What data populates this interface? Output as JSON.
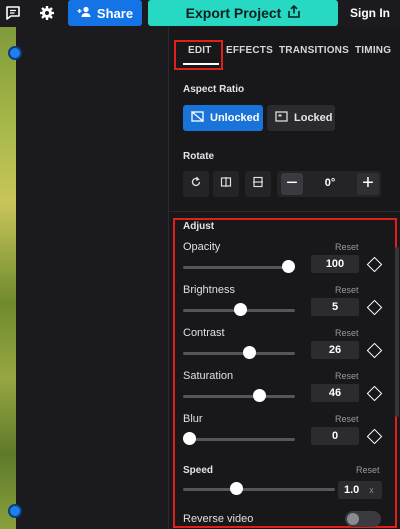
{
  "topbar": {
    "share_label": "Share",
    "export_label": "Export Project",
    "signin_label": "Sign In",
    "icons": [
      "chat-icon",
      "gear-icon",
      "add-user-icon",
      "share-out-icon"
    ]
  },
  "tabs": [
    {
      "label": "EDIT",
      "active": true
    },
    {
      "label": "EFFECTS"
    },
    {
      "label": "TRANSITIONS"
    },
    {
      "label": "TIMING"
    }
  ],
  "aspect_ratio": {
    "title": "Aspect Ratio",
    "unlocked_label": "Unlocked",
    "locked_label": "Locked"
  },
  "rotate": {
    "title": "Rotate",
    "value": "0°",
    "minus": "−",
    "plus": "+"
  },
  "adjust": {
    "title": "Adjust",
    "reset_label": "Reset",
    "rows": [
      {
        "label": "Opacity",
        "value": "100",
        "fraction": 1.0
      },
      {
        "label": "Brightness",
        "value": "5",
        "fraction": 0.52
      },
      {
        "label": "Contrast",
        "value": "26",
        "fraction": 0.61
      },
      {
        "label": "Saturation",
        "value": "46",
        "fraction": 0.71
      },
      {
        "label": "Blur",
        "value": "0",
        "fraction": 0.0
      }
    ]
  },
  "speed": {
    "title": "Speed",
    "reset_label": "Reset",
    "value": "1.0",
    "unit": "x",
    "fraction": 0.34
  },
  "reverse": {
    "label": "Reverse video",
    "enabled": false
  },
  "colors": {
    "accent_blue": "#1a73d9",
    "export_teal": "#27d8c2",
    "highlight_red": "#e0201a"
  }
}
